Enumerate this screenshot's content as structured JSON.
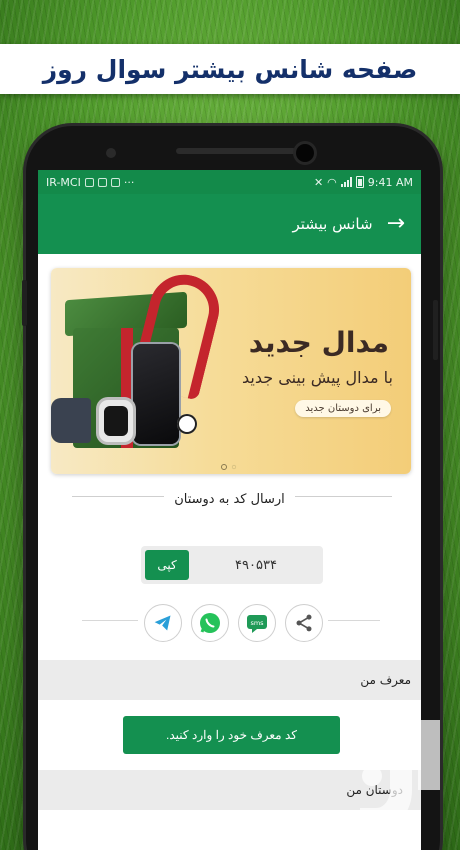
{
  "promo": {
    "headline": "صفحه شانس بیشتر سوال روز"
  },
  "status_bar": {
    "carrier": "IR-MCI",
    "time": "9:41 AM"
  },
  "app_bar": {
    "title": "شانس بیشتر"
  },
  "slider": {
    "title": "مدال جدید",
    "subtitle": "با مدال پیش بینی جدید",
    "pill": "برای دوستان جدید",
    "active_index": 0,
    "slide_count": 2
  },
  "send_code": {
    "section_title": "ارسال کد به دوستان",
    "code": "۴۹۰۵۳۴",
    "copy_label": "کپی"
  },
  "share": {
    "buttons": [
      {
        "name": "share-icon"
      },
      {
        "name": "sms-icon",
        "label": "sms"
      },
      {
        "name": "whatsapp-icon"
      },
      {
        "name": "telegram-icon"
      }
    ]
  },
  "referrer": {
    "section_title": "معرف من",
    "button_label": "کد معرف خود را وارد کنید."
  },
  "friends": {
    "section_title": "دوستان من"
  },
  "colors": {
    "primary_green": "#149050",
    "status_green": "#138a4a",
    "promo_text": "#14306a"
  }
}
